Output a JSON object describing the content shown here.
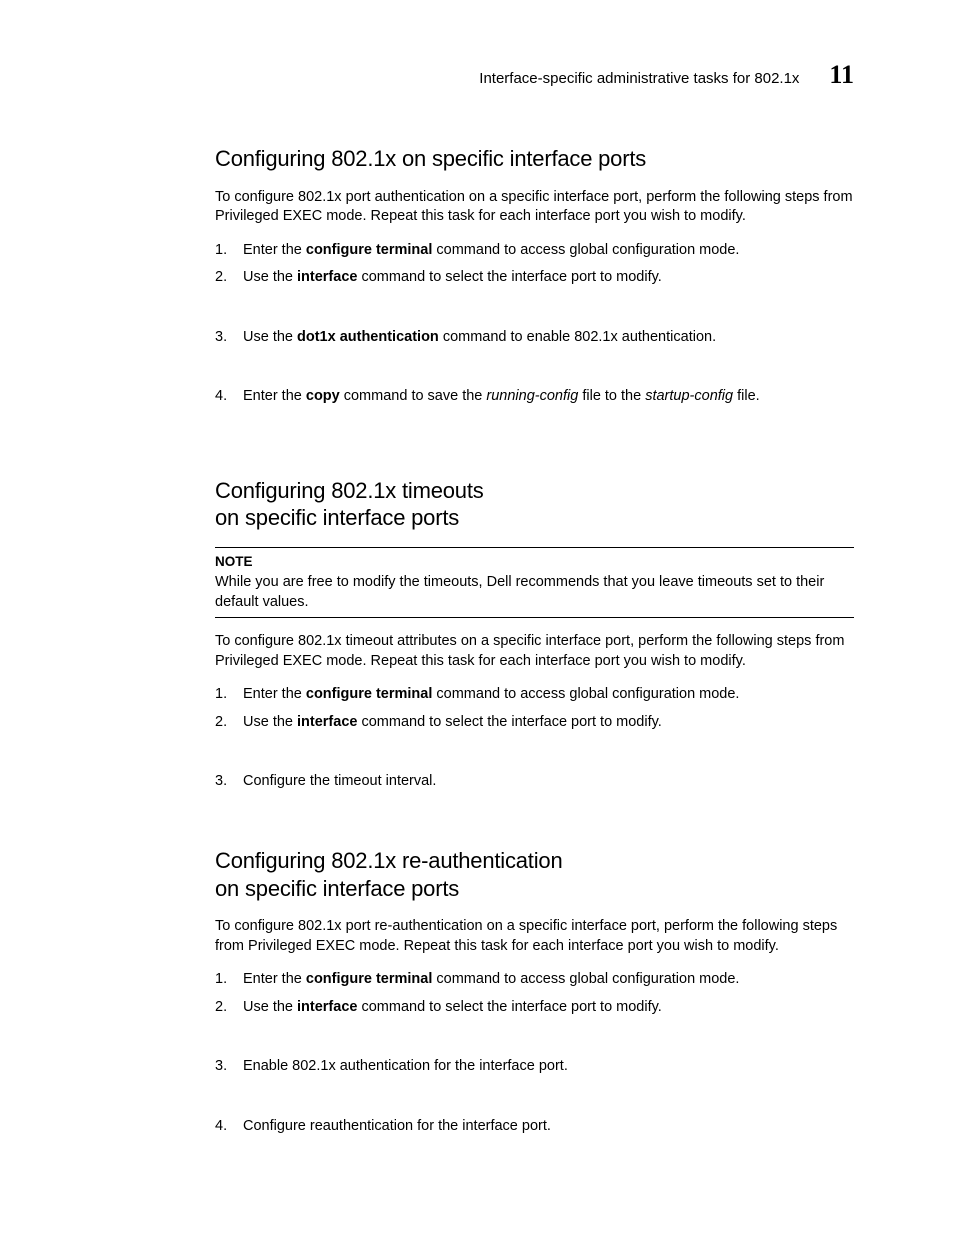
{
  "header": {
    "running_title": "Interface-specific administrative tasks for 802.1x",
    "chapter_number": "11"
  },
  "section1": {
    "title": "Configuring 802.1x on specific interface ports",
    "intro": "To configure 802.1x port authentication on a specific interface port, perform the following steps from Privileged EXEC mode. Repeat this task for each interface port you wish to modify.",
    "step1_num": "1.",
    "step1_pre": "Enter the ",
    "step1_bold": "configure terminal",
    "step1_post": " command to access global configuration mode.",
    "step2_num": "2.",
    "step2_pre": "Use the ",
    "step2_bold": "interface",
    "step2_post": " command to select the interface port to modify.",
    "step3_num": "3.",
    "step3_pre": "Use the ",
    "step3_bold": "dot1x authentication",
    "step3_post": " command to enable 802.1x authentication.",
    "step4_num": "4.",
    "step4_pre": "Enter the ",
    "step4_bold": "copy",
    "step4_post1": " command to save the ",
    "step4_it1": "running-config",
    "step4_post2": " file to the ",
    "step4_it2": "startup-config",
    "step4_post3": " file."
  },
  "section2": {
    "title_line1": "Configuring 802.1x timeouts",
    "title_line2": "on specific interface ports",
    "note_label": "NOTE",
    "note_text": "While you are free to modify the timeouts, Dell recommends that you leave timeouts set to their default values.",
    "intro": "To configure 802.1x timeout attributes on a specific interface port, perform the following steps from Privileged EXEC mode. Repeat this task for each interface port you wish to modify.",
    "step1_num": "1.",
    "step1_pre": "Enter the ",
    "step1_bold": "configure terminal",
    "step1_post": " command to access global configuration mode.",
    "step2_num": "2.",
    "step2_pre": "Use the ",
    "step2_bold": "interface",
    "step2_post": " command to select the interface port to modify.",
    "step3_num": "3.",
    "step3_text": "Configure the timeout interval."
  },
  "section3": {
    "title_line1": "Configuring 802.1x re-authentication",
    "title_line2": "on specific interface ports",
    "intro": "To configure 802.1x port re-authentication on a specific interface port, perform the following steps from Privileged EXEC mode. Repeat this task for each interface port you wish to modify.",
    "step1_num": "1.",
    "step1_pre": "Enter the ",
    "step1_bold": "configure terminal",
    "step1_post": " command to access global configuration mode.",
    "step2_num": "2.",
    "step2_pre": "Use the ",
    "step2_bold": "interface",
    "step2_post": " command to select the interface port to modify.",
    "step3_num": "3.",
    "step3_text": "Enable 802.1x authentication for the interface port.",
    "step4_num": "4.",
    "step4_text": "Configure reauthentication for the interface port."
  }
}
